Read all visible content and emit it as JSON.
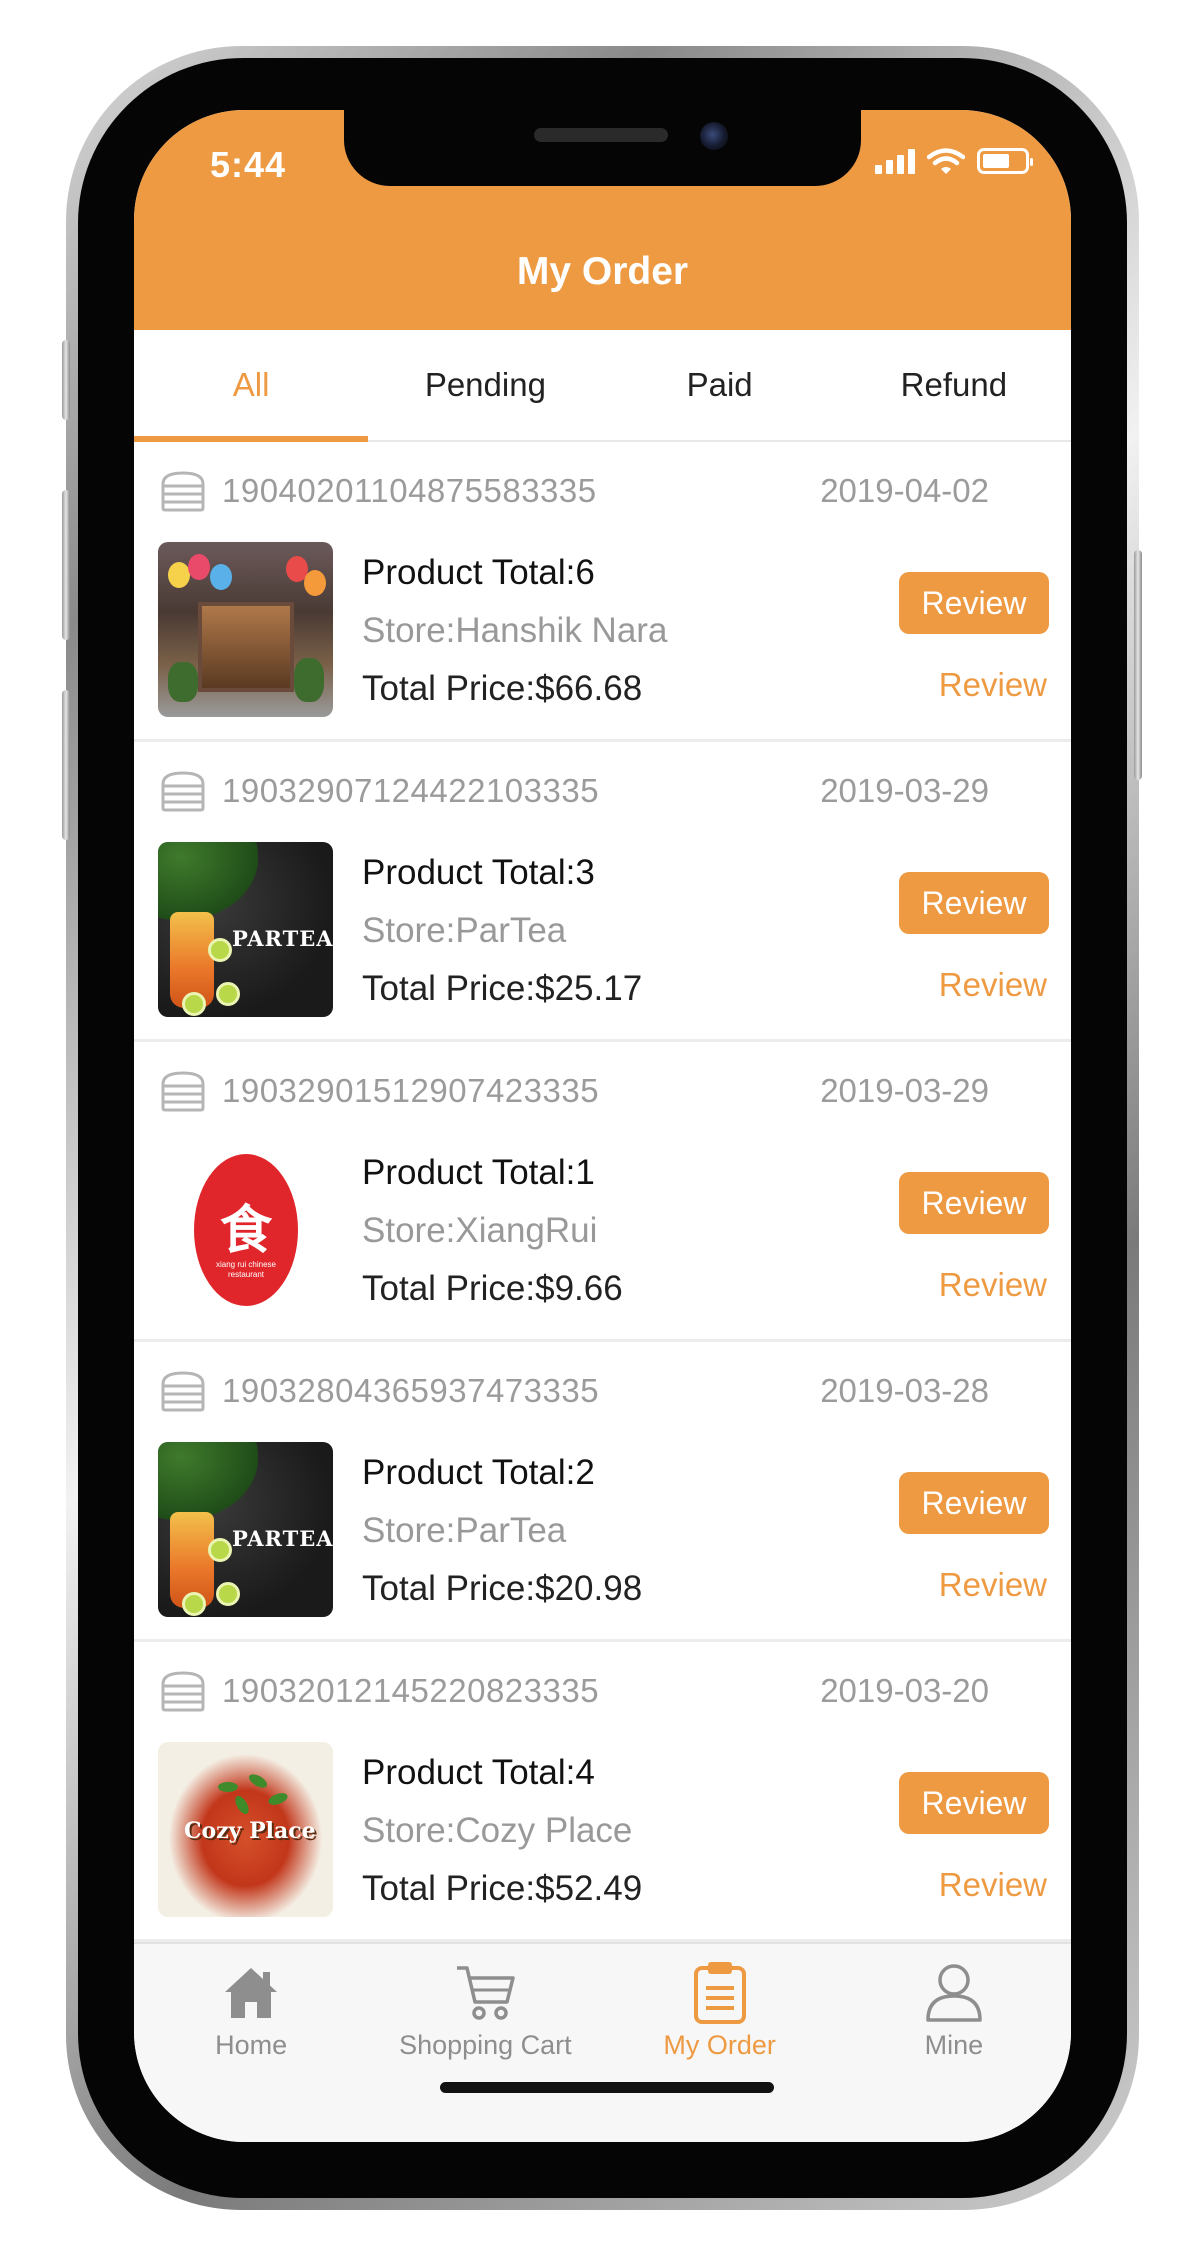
{
  "status_bar": {
    "time": "5:44"
  },
  "header": {
    "title": "My Order"
  },
  "tabs": [
    {
      "label": "All",
      "active": true
    },
    {
      "label": "Pending",
      "active": false
    },
    {
      "label": "Paid",
      "active": false
    },
    {
      "label": "Refund",
      "active": false
    }
  ],
  "orders": [
    {
      "order_no": "19040201104875583335",
      "date": "2019-04-02",
      "product_total": "Product Total:6",
      "store": "Store:Hanshik Nara",
      "price": "Total Price:$66.68",
      "button_label": "Review",
      "link_label": "Review"
    },
    {
      "order_no": "19032907124422103335",
      "date": "2019-03-29",
      "product_total": "Product Total:3",
      "store": "Store:ParTea",
      "price": "Total Price:$25.17",
      "button_label": "Review",
      "link_label": "Review",
      "logo_text": "PARTEA"
    },
    {
      "order_no": "19032901512907423335",
      "date": "2019-03-29",
      "product_total": "Product Total:1",
      "store": "Store:XiangRui",
      "price": "Total Price:$9.66",
      "button_label": "Review",
      "link_label": "Review",
      "logo_text": "食",
      "logo_sub": "xiang rui chinese restaurant"
    },
    {
      "order_no": "19032804365937473335",
      "date": "2019-03-28",
      "product_total": "Product Total:2",
      "store": "Store:ParTea",
      "price": "Total Price:$20.98",
      "button_label": "Review",
      "link_label": "Review",
      "logo_text": "PARTEA"
    },
    {
      "order_no": "19032012145220823335",
      "date": "2019-03-20",
      "product_total": "Product Total:4",
      "store": "Store:Cozy Place",
      "price": "Total Price:$52.49",
      "button_label": "Review",
      "link_label": "Review",
      "logo_text": "Cozy Place"
    }
  ],
  "bottom_nav": [
    {
      "label": "Home",
      "icon": "home-icon",
      "active": false
    },
    {
      "label": "Shopping Cart",
      "icon": "cart-icon",
      "active": false
    },
    {
      "label": "My Order",
      "icon": "clipboard-icon",
      "active": true
    },
    {
      "label": "Mine",
      "icon": "user-icon",
      "active": false
    }
  ],
  "colors": {
    "accent": "#ee9a43",
    "text_muted": "#9b9b9b",
    "background": "#f7f7f7"
  }
}
